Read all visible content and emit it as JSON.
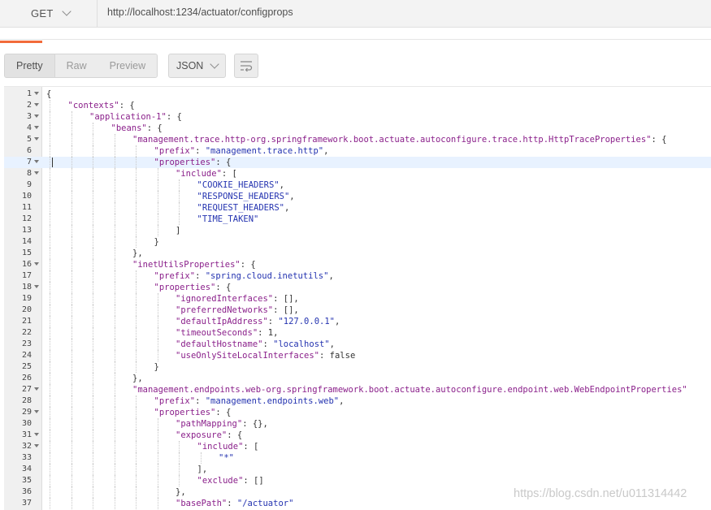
{
  "request": {
    "method": "GET",
    "url": "http://localhost:1234/actuator/configprops"
  },
  "toolbar": {
    "views": [
      "Pretty",
      "Raw",
      "Preview"
    ],
    "active_view": "Pretty",
    "format": "JSON",
    "wrap_icon": "wrap-lines-icon"
  },
  "editor": {
    "highlighted_line": 7,
    "lines": [
      {
        "n": "1",
        "fold": true,
        "depth": 0,
        "key": "",
        "val": "",
        "punct": "{"
      },
      {
        "n": "2",
        "fold": true,
        "depth": 1,
        "key": "\"contexts\"",
        "val": "",
        "punct": ": {"
      },
      {
        "n": "3",
        "fold": true,
        "depth": 2,
        "key": "\"application-1\"",
        "val": "",
        "punct": ": {"
      },
      {
        "n": "4",
        "fold": true,
        "depth": 3,
        "key": "\"beans\"",
        "val": "",
        "punct": ": {"
      },
      {
        "n": "5",
        "fold": true,
        "depth": 4,
        "key": "\"management.trace.http-org.springframework.boot.actuate.autoconfigure.trace.http.HttpTraceProperties\"",
        "val": "",
        "punct": ": {"
      },
      {
        "n": "6",
        "fold": false,
        "depth": 5,
        "key": "\"prefix\"",
        "val": "\"management.trace.http\"",
        "punct": ","
      },
      {
        "n": "7",
        "fold": true,
        "depth": 5,
        "key": "\"properties\"",
        "val": "",
        "punct": ": {"
      },
      {
        "n": "8",
        "fold": true,
        "depth": 6,
        "key": "\"include\"",
        "val": "",
        "punct": ": ["
      },
      {
        "n": "9",
        "fold": false,
        "depth": 7,
        "key": "",
        "val": "\"COOKIE_HEADERS\"",
        "punct": ","
      },
      {
        "n": "10",
        "fold": false,
        "depth": 7,
        "key": "",
        "val": "\"RESPONSE_HEADERS\"",
        "punct": ","
      },
      {
        "n": "11",
        "fold": false,
        "depth": 7,
        "key": "",
        "val": "\"REQUEST_HEADERS\"",
        "punct": ","
      },
      {
        "n": "12",
        "fold": false,
        "depth": 7,
        "key": "",
        "val": "\"TIME_TAKEN\"",
        "punct": ""
      },
      {
        "n": "13",
        "fold": false,
        "depth": 6,
        "key": "",
        "val": "",
        "punct": "]"
      },
      {
        "n": "14",
        "fold": false,
        "depth": 5,
        "key": "",
        "val": "",
        "punct": "}"
      },
      {
        "n": "15",
        "fold": false,
        "depth": 4,
        "key": "",
        "val": "",
        "punct": "},"
      },
      {
        "n": "16",
        "fold": true,
        "depth": 4,
        "key": "\"inetUtilsProperties\"",
        "val": "",
        "punct": ": {"
      },
      {
        "n": "17",
        "fold": false,
        "depth": 5,
        "key": "\"prefix\"",
        "val": "\"spring.cloud.inetutils\"",
        "punct": ","
      },
      {
        "n": "18",
        "fold": true,
        "depth": 5,
        "key": "\"properties\"",
        "val": "",
        "punct": ": {"
      },
      {
        "n": "19",
        "fold": false,
        "depth": 6,
        "key": "\"ignoredInterfaces\"",
        "val": "",
        "punct": ": [],"
      },
      {
        "n": "20",
        "fold": false,
        "depth": 6,
        "key": "\"preferredNetworks\"",
        "val": "",
        "punct": ": [],"
      },
      {
        "n": "21",
        "fold": false,
        "depth": 6,
        "key": "\"defaultIpAddress\"",
        "val": "\"127.0.0.1\"",
        "punct": ","
      },
      {
        "n": "22",
        "fold": false,
        "depth": 6,
        "key": "\"timeoutSeconds\"",
        "val": "",
        "punct": ": 1,"
      },
      {
        "n": "23",
        "fold": false,
        "depth": 6,
        "key": "\"defaultHostname\"",
        "val": "\"localhost\"",
        "punct": ","
      },
      {
        "n": "24",
        "fold": false,
        "depth": 6,
        "key": "\"useOnlySiteLocalInterfaces\"",
        "val": "",
        "punct": ": false"
      },
      {
        "n": "25",
        "fold": false,
        "depth": 5,
        "key": "",
        "val": "",
        "punct": "}"
      },
      {
        "n": "26",
        "fold": false,
        "depth": 4,
        "key": "",
        "val": "",
        "punct": "},"
      },
      {
        "n": "27",
        "fold": true,
        "depth": 4,
        "key": "\"management.endpoints.web-org.springframework.boot.actuate.autoconfigure.endpoint.web.WebEndpointProperties\"",
        "val": "",
        "punct": ""
      },
      {
        "n": "28",
        "fold": false,
        "depth": 5,
        "key": "\"prefix\"",
        "val": "\"management.endpoints.web\"",
        "punct": ","
      },
      {
        "n": "29",
        "fold": true,
        "depth": 5,
        "key": "\"properties\"",
        "val": "",
        "punct": ": {"
      },
      {
        "n": "30",
        "fold": false,
        "depth": 6,
        "key": "\"pathMapping\"",
        "val": "",
        "punct": ": {},"
      },
      {
        "n": "31",
        "fold": true,
        "depth": 6,
        "key": "\"exposure\"",
        "val": "",
        "punct": ": {"
      },
      {
        "n": "32",
        "fold": true,
        "depth": 7,
        "key": "\"include\"",
        "val": "",
        "punct": ": ["
      },
      {
        "n": "33",
        "fold": false,
        "depth": 8,
        "key": "",
        "val": "\"*\"",
        "punct": ""
      },
      {
        "n": "34",
        "fold": false,
        "depth": 7,
        "key": "",
        "val": "",
        "punct": "],"
      },
      {
        "n": "35",
        "fold": false,
        "depth": 7,
        "key": "\"exclude\"",
        "val": "",
        "punct": ": []"
      },
      {
        "n": "36",
        "fold": false,
        "depth": 6,
        "key": "",
        "val": "",
        "punct": "},"
      },
      {
        "n": "37",
        "fold": false,
        "depth": 6,
        "key": "\"basePath\"",
        "val": "\"/actuator\"",
        "punct": ""
      }
    ]
  },
  "watermark": "https://blog.csdn.net/u011314442"
}
